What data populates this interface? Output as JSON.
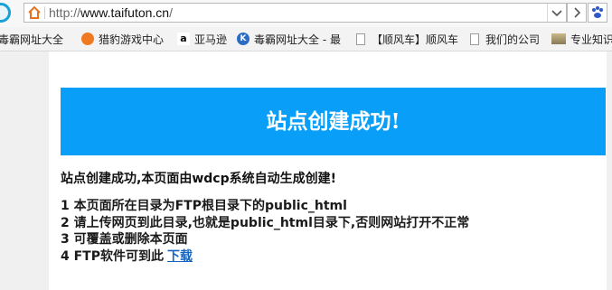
{
  "browser": {
    "url_prefix": "http://",
    "url_host": "www.taifuton.cn",
    "url_suffix": "/"
  },
  "bookmarks": [
    {
      "icon": "ie-logo-icon",
      "label": "毒霸网址大全"
    },
    {
      "icon": "cheetah-icon",
      "label": "猎豹游戏中心"
    },
    {
      "icon": "amazon-icon",
      "label": "亚马逊"
    },
    {
      "icon": "k-logo-icon",
      "label": "毒霸网址大全 - 最"
    },
    {
      "icon": "page-icon",
      "label": "【顺风车】顺风车"
    },
    {
      "icon": "page-icon",
      "label": "我们的公司"
    },
    {
      "icon": "thumbnail-icon",
      "label": "专业知识"
    }
  ],
  "page": {
    "banner_title": "站点创建成功!",
    "intro": "站点创建成功,本页面由wdcp系统自动生成创建!",
    "items": [
      "1 本页面所在目录为FTP根目录下的public_html",
      "2 请上传网页到此目录,也就是public_html目录下,否则网站打开不正常",
      "3 可覆盖或删除本页面",
      "4 FTP软件可到此"
    ],
    "download_link": "下载"
  },
  "colors": {
    "banner": "#099ff9",
    "link": "#1565c0"
  }
}
